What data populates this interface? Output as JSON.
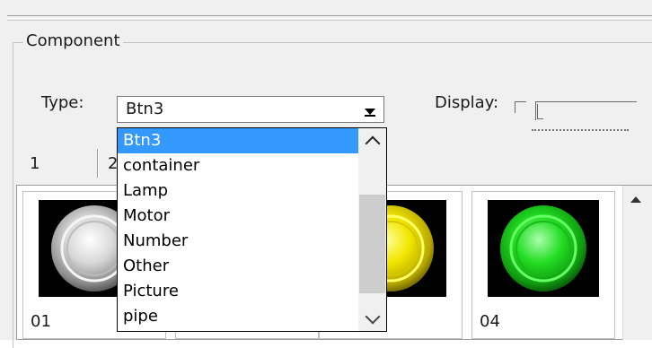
{
  "group": {
    "title": "Component"
  },
  "type_field": {
    "label": "Type:",
    "value": "Btn3"
  },
  "display_field": {
    "label": "Display:"
  },
  "tabs": [
    {
      "label": "1"
    },
    {
      "label": "2"
    }
  ],
  "dropdown_options": [
    {
      "label": "Btn3",
      "selected": true
    },
    {
      "label": "container"
    },
    {
      "label": "Lamp"
    },
    {
      "label": "Motor"
    },
    {
      "label": "Number"
    },
    {
      "label": "Other"
    },
    {
      "label": "Picture"
    },
    {
      "label": "pipe"
    }
  ],
  "tiles": [
    {
      "label": "01",
      "icon": "white-button-icon"
    },
    {
      "label": "",
      "icon": "hidden-button-icon"
    },
    {
      "label": "",
      "icon": "yellow-button-icon"
    },
    {
      "label": "04",
      "icon": "green-button-icon"
    }
  ],
  "colors": {
    "selection": "#3399ff",
    "white_button": "#d8d8d8",
    "yellow_button": "#f2e600",
    "green_button": "#22dd22"
  }
}
